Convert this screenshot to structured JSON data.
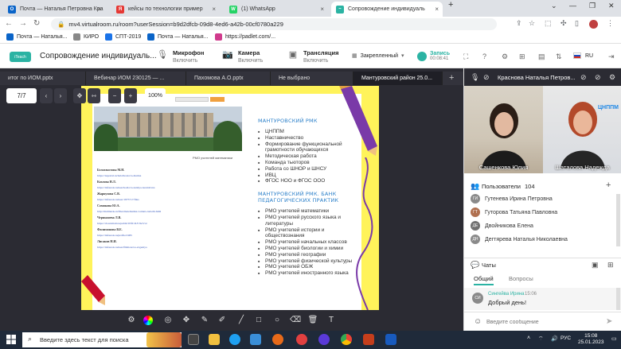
{
  "browser": {
    "tabs": [
      {
        "label": "Почта — Наталья Петровна Кра",
        "color": "#0a64c8",
        "glyph": "O"
      },
      {
        "label": "кейсы по технологии пример",
        "color": "#e53935",
        "glyph": "Я"
      },
      {
        "label": "(1) WhatsApp",
        "color": "#25d366",
        "glyph": "W"
      },
      {
        "label": "Сопровождение индивидуаль",
        "color": "#2bb3a3",
        "glyph": "~"
      }
    ],
    "new_tab": "+",
    "url": "mv4.virtualroom.ru/room?userSession=b9d2dfcb-09d8-4ed6-a42b-00cf0780a229",
    "bookmarks": [
      {
        "label": "Почта — Наталья...",
        "color": "#0a64c8"
      },
      {
        "label": "КИРО",
        "color": "#888888"
      },
      {
        "label": "СПТ-2019",
        "color": "#1a73e8"
      },
      {
        "label": "Почта — Наталья...",
        "color": "#0a64c8"
      },
      {
        "label": "https://padlet.com/...",
        "color": "#d03a8c"
      }
    ]
  },
  "app": {
    "title": "Сопровождение индивидуаль...",
    "logo": "iTeach",
    "controls": [
      {
        "title": "Микрофон",
        "sub": "Включить",
        "icon": "mic-off-icon"
      },
      {
        "title": "Камера",
        "sub": "Включить",
        "icon": "camera-off-icon"
      },
      {
        "title": "Трансляция",
        "sub": "Включить",
        "icon": "broadcast-icon"
      }
    ],
    "layout_label": "Закрепленный",
    "record_label": "Запись",
    "record_time": "00:08:41",
    "language": "RU",
    "accent_color": "#2bb3a3"
  },
  "workspace": {
    "doc_tabs": [
      "итог по ИОМ.pptx",
      "Вебинар ИОМ 230125 — ...",
      "Пахомова А.О.pptx",
      "Не выбрано",
      "Мантуровский район 25.0..."
    ],
    "page_indicator": "7/7",
    "zoom": "100%",
    "slide": {
      "rmo_caption": "РМО учителей математики",
      "links": [
        {
          "name": "Белохвостова М.Н.",
          "url": "https://nsportal.ru/belohvostova-marina"
        },
        {
          "name": "Козлова Н.Л.",
          "url": "https://infourok.ru/user/kozlova-natalya-leonidovna"
        },
        {
          "name": "Жарнухова С.В.",
          "url": "https://infourok.ru/user/1875717/files"
        },
        {
          "name": "Сомикова Ю.А.",
          "url": "http://multiurok.ru/files/matematika-variant-zadachi.html"
        },
        {
          "name": "Чернышева Л.В.",
          "url": "https://cloud.mail.ru/public/65fC/iLYJGtVcz"
        },
        {
          "name": "Филимонова В.Е.",
          "url": "https://infourok.ru/profile/1985"
        },
        {
          "name": "Лисаков Н.И.",
          "url": "https://infourok.ru/user/filimonova-evgeniya"
        }
      ],
      "section1_title": "МАНТУРОВСКИЙ РМК",
      "section1_items": [
        "ЦНППМ",
        "Наставничество",
        "Формирование функциональной грамотности обучающихся",
        "Методическая работа",
        "Команда тьюторов",
        "Работа со ШНОР и ШНСУ",
        "ИВЦ",
        "ФГОС НОО и ФГОС ООО"
      ],
      "section2_title": "МАНТУРОВСКИЙ РМК. БАНК ПЕДАГОГИЧЕСКИХ ПРАКТИК",
      "section2_items": [
        "РМО учителей математики",
        "РМО учителей русского языка и литературы",
        "РМО учителей истории и обществознания",
        "РМО учителей начальных классов",
        "РМО учителей биологии и химии",
        "РМО учителей географии",
        "РМО учителей физической культуры",
        "РМО учителей ОБЖ",
        "РМО учителей иностранного языка"
      ]
    },
    "draw_tools": [
      "settings-icon",
      "color-icon",
      "palette-icon",
      "move-icon",
      "pen-icon",
      "marker-icon",
      "line-icon",
      "rectangle-icon",
      "circle-icon",
      "eraser-icon",
      "trash-icon",
      "text-icon"
    ]
  },
  "sidebar": {
    "presenter": "Краснова Наталья Петров...",
    "videos": [
      {
        "name": "Сашенкова Юлия"
      },
      {
        "name": "Шаталова Надежда"
      }
    ],
    "users_label": "Пользователи",
    "users_count": "104",
    "users": [
      {
        "initials": "ГИ",
        "name": "Гутенева Ирина Петровна",
        "color": "#8a8a8a"
      },
      {
        "initials": "ГТ",
        "name": "Гуторова Татьяна Павловна",
        "color": "#b07050"
      },
      {
        "initials": "ДЕ",
        "name": "Двойникова Елена",
        "color": "#707070"
      },
      {
        "initials": "ДН",
        "name": "Дегтярева Наталья Николаевна",
        "color": "#8a8a8a"
      }
    ],
    "chats_label": "Чаты",
    "chat_tabs": [
      "Общий",
      "Вопросы"
    ],
    "message": {
      "initials": "СИ",
      "author": "Сингейва Ирина",
      "time": "15:06",
      "text": "Добрый день!"
    },
    "input_placeholder": "Введите сообщение"
  },
  "taskbar": {
    "search_placeholder": "Введите здесь текст для поиска",
    "lang": "РУС",
    "time": "15:08",
    "date": "25.01.2023"
  }
}
